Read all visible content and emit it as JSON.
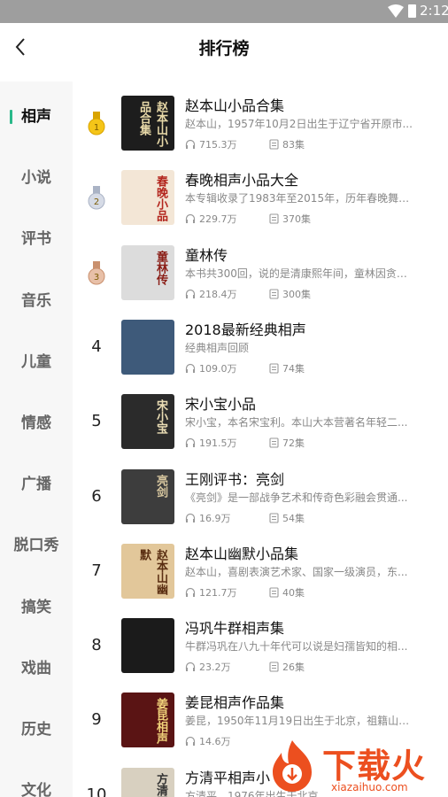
{
  "status_bar": {
    "time": "2:12"
  },
  "header": {
    "title": "排行榜"
  },
  "sidebar": {
    "items": [
      {
        "label": "相声",
        "active": true
      },
      {
        "label": "小说",
        "active": false
      },
      {
        "label": "评书",
        "active": false
      },
      {
        "label": "音乐",
        "active": false
      },
      {
        "label": "儿童",
        "active": false
      },
      {
        "label": "情感",
        "active": false
      },
      {
        "label": "广播",
        "active": false
      },
      {
        "label": "脱口秀",
        "active": false
      },
      {
        "label": "搞笑",
        "active": false
      },
      {
        "label": "戏曲",
        "active": false
      },
      {
        "label": "历史",
        "active": false
      },
      {
        "label": "文化",
        "active": false
      }
    ]
  },
  "ranking": {
    "items": [
      {
        "rank": "1",
        "medal": "gold",
        "title": "赵本山小品合集",
        "desc": "赵本山，1957年10月2日出生于辽宁省开原市...",
        "plays": "715.3万",
        "episodes": "83集",
        "cover_text": "赵本山小品合集",
        "cover_bg": "#1d1d1d",
        "cover_fg": "#e8d9a8"
      },
      {
        "rank": "2",
        "medal": "silver",
        "title": "春晚相声小品大全",
        "desc": "本专辑收录了1983年至2015年，历年春晚舞台...",
        "plays": "229.7万",
        "episodes": "370集",
        "cover_text": "春晚小品",
        "cover_bg": "#f3e6d6",
        "cover_fg": "#b3261e"
      },
      {
        "rank": "3",
        "medal": "bronze",
        "title": "童林传",
        "desc": "本书共300回，说的是清康熙年间，童林因贪恋...",
        "plays": "218.4万",
        "episodes": "300集",
        "cover_text": "童林传",
        "cover_bg": "#dcdcdc",
        "cover_fg": "#8a1d16"
      },
      {
        "rank": "4",
        "medal": "",
        "title": "2018最新经典相声",
        "desc": "经典相声回顾",
        "plays": "109.0万",
        "episodes": "74集",
        "cover_text": "",
        "cover_bg": "#3e5a7a",
        "cover_fg": "#ffffff"
      },
      {
        "rank": "5",
        "medal": "",
        "title": "宋小宝小品",
        "desc": "宋小宝，本名宋宝利。本山大本营著名年轻二...",
        "plays": "191.5万",
        "episodes": "72集",
        "cover_text": "宋小宝",
        "cover_bg": "#2b2b2b",
        "cover_fg": "#e9dcb4"
      },
      {
        "rank": "6",
        "medal": "",
        "title": "王刚评书：亮剑",
        "desc": "《亮剑》是一部战争艺术和传奇色彩融会贯通...",
        "plays": "16.9万",
        "episodes": "54集",
        "cover_text": "亮剑",
        "cover_bg": "#3d3d3d",
        "cover_fg": "#d9c8a0"
      },
      {
        "rank": "7",
        "medal": "",
        "title": "赵本山幽默小品集",
        "desc": "赵本山，喜剧表演艺术家、国家一级演员，东...",
        "plays": "121.7万",
        "episodes": "40集",
        "cover_text": "赵本山幽默",
        "cover_bg": "#e2c79a",
        "cover_fg": "#5a2e12"
      },
      {
        "rank": "8",
        "medal": "",
        "title": "冯巩牛群相声集",
        "desc": "牛群冯巩在八九十年代可以说是妇孺皆知的相...",
        "plays": "23.2万",
        "episodes": "26集",
        "cover_text": "",
        "cover_bg": "#1b1b1b",
        "cover_fg": "#ffffff"
      },
      {
        "rank": "9",
        "medal": "",
        "title": "姜昆相声作品集",
        "desc": "姜昆，1950年11月19日出生于北京，祖籍山东...",
        "plays": "14.6万",
        "episodes": "",
        "cover_text": "姜昆相声",
        "cover_bg": "#5a1414",
        "cover_fg": "#f0d27a"
      },
      {
        "rank": "10",
        "medal": "",
        "title": "方清平相声小",
        "desc": "方清平，1976年出生于北京",
        "plays": "",
        "episodes": "",
        "cover_text": "方清平",
        "cover_bg": "#d8d0c0",
        "cover_fg": "#333333"
      }
    ]
  },
  "watermark": {
    "brand": "下载火",
    "url": "xiazaihuo.com"
  },
  "colors": {
    "accent": "#2ab98a",
    "status_bar": "#9e9e9e",
    "watermark": "#ec4f1f"
  },
  "icons": {
    "back": "back-arrow-icon",
    "plays": "headphones-icon",
    "episodes": "episodes-icon"
  }
}
